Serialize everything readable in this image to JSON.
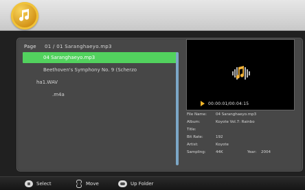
{
  "app": {
    "accent": "#52d25e",
    "header_icon": "music-note-icon"
  },
  "list": {
    "page_label": "Page",
    "page_value": "01 / 01 Saranghaeyo.mp3",
    "items": [
      {
        "label": "04 Saranghaeyo.mp3",
        "selected": true
      },
      {
        "label": "Beethoven's Symphony No. 9 (Scherzo",
        "selected": false
      },
      {
        "label": "ha1.WAV",
        "selected": false
      },
      {
        "label": ".m4a",
        "selected": false
      }
    ]
  },
  "preview": {
    "icon": "audio-wave-note-icon",
    "time": "00:00:01/00:04:15"
  },
  "info": {
    "file_name_label": "File Name:",
    "file_name_value": "04 Saranghaeyo.mp3",
    "album_label": "Album:",
    "album_value": "Koyote Vol.7: Rainbo",
    "title_label": "Title:",
    "title_value": "",
    "bit_rate_label": "Bit Rate:",
    "bit_rate_value": "192",
    "artist_label": "Artist:",
    "artist_value": "Koyote",
    "sampling_label": "Sampling:",
    "sampling_value": "44K",
    "year_label": "Year:",
    "year_value": "2004"
  },
  "bottom_bar": {
    "select_label": "Select",
    "move_label": "Move",
    "folder_label": "Up Folder"
  }
}
